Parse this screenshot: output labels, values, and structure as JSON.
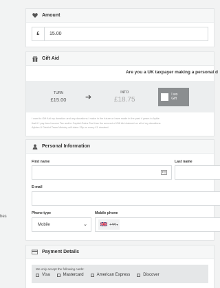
{
  "side_text": "hes",
  "amount": {
    "heading": "Amount",
    "currency_symbol": "£",
    "value": "15.00"
  },
  "gift_aid": {
    "heading": "Gift Aid",
    "question": "Are you a UK taxpayer making a personal d",
    "turn_label": "TURN",
    "turn_value": "£15.00",
    "into_label": "INTO",
    "into_value": "£18.75",
    "button_text_line1": "I wo",
    "button_text_line2": "Gift",
    "small_print": [
      "I want to Gift Aid my donation and any donations I make in the future or have made in the past 4 years to Aylde",
      "that if I pay less Income Tax and/or Capital Gains Tax than the amount of Gift Aid claimed on all of my donations",
      "Aylden & District Team Ministry will claim 25p on every £1 donated."
    ]
  },
  "personal": {
    "heading": "Personal Information",
    "first_name_label": "First name",
    "last_name_label": "Last name",
    "email_label": "E-mail",
    "phone_type_label": "Phone type",
    "phone_type_value": "Mobile",
    "mobile_label": "Mobile phone",
    "country_code": "+44"
  },
  "payment": {
    "heading": "Payment Details",
    "accepted_text": "We only accept the following cards:",
    "cards": [
      "Visa",
      "Mastercard",
      "American Express",
      "Discover"
    ]
  }
}
